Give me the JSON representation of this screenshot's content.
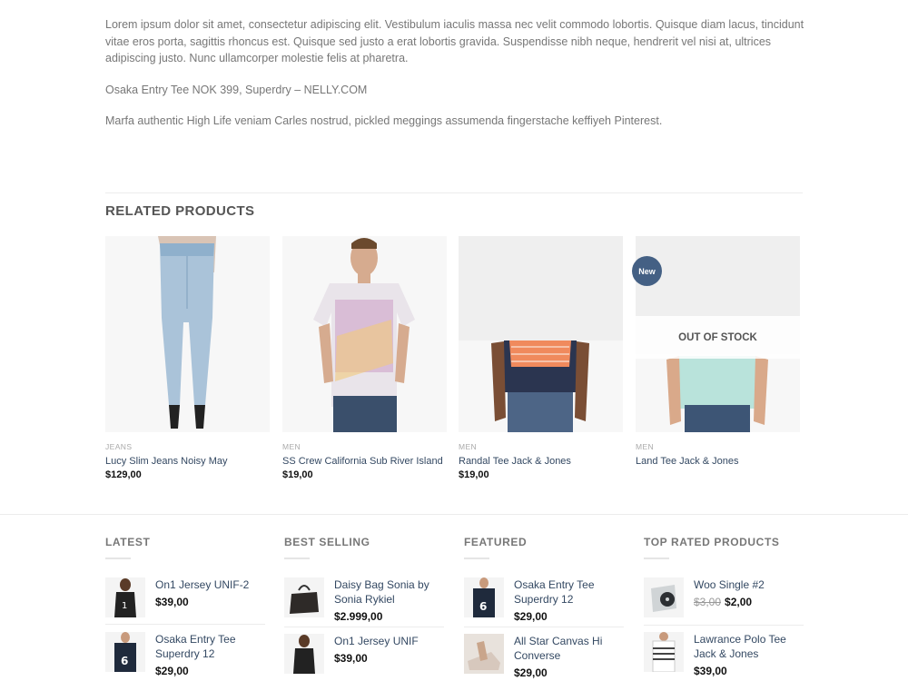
{
  "description": {
    "p1": "Lorem ipsum dolor sit amet, consectetur adipiscing elit. Vestibulum iaculis massa nec velit commodo lobortis. Quisque diam lacus, tincidunt vitae eros porta, sagittis rhoncus est. Quisque sed justo a erat lobortis gravida. Suspendisse nibh neque, hendrerit vel nisi at, ultrices adipiscing justo. Nunc ullamcorper molestie felis at pharetra.",
    "p2": "Osaka Entry Tee NOK 399, Superdry – NELLY.COM",
    "p3": "Marfa authentic High Life veniam Carles nostrud, pickled meggings assumenda fingerstache keffiyeh Pinterest."
  },
  "related": {
    "title": "RELATED PRODUCTS",
    "products": [
      {
        "category": "JEANS",
        "name": "Lucy Slim Jeans Noisy May",
        "price": "$129,00"
      },
      {
        "category": "MEN",
        "name": "SS Crew California Sub River Island",
        "price": "$19,00"
      },
      {
        "category": "MEN",
        "name": "Randal Tee Jack & Jones",
        "price": "$19,00"
      },
      {
        "category": "MEN",
        "name": "Land Tee Jack & Jones",
        "price": "",
        "badge": "New",
        "stock": "OUT OF STOCK"
      }
    ]
  },
  "widgets": {
    "latest": {
      "title": "LATEST",
      "items": [
        {
          "name": "On1 Jersey UNIF-2",
          "price": "$39,00"
        },
        {
          "name": "Osaka Entry Tee Superdry 12",
          "price": "$29,00"
        }
      ]
    },
    "best_selling": {
      "title": "BEST SELLING",
      "items": [
        {
          "name": "Daisy Bag Sonia by Sonia Rykiel",
          "price": "$2.999,00"
        },
        {
          "name": "On1 Jersey UNIF",
          "price": "$39,00"
        }
      ]
    },
    "featured": {
      "title": "FEATURED",
      "items": [
        {
          "name": "Osaka Entry Tee Superdry 12",
          "price": "$29,00"
        },
        {
          "name": "All Star Canvas Hi Converse",
          "price": "$29,00"
        }
      ]
    },
    "top_rated": {
      "title": "TOP RATED PRODUCTS",
      "items": [
        {
          "name": "Woo Single #2",
          "old_price": "$3,00",
          "price": "$2,00"
        },
        {
          "name": "Lawrance Polo Tee Jack & Jones",
          "price": "$39,00"
        }
      ]
    }
  },
  "colors": {
    "link": "#334862",
    "badge": "#446084",
    "price": "#111111"
  }
}
